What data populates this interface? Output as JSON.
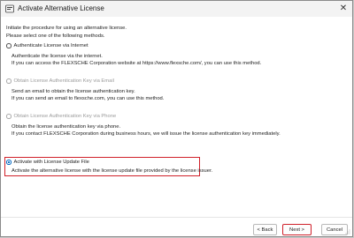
{
  "window": {
    "title": "Activate Alternative License",
    "close_glyph": "✕"
  },
  "intro": {
    "line1": "Initiate the procedure for using an alternative license.",
    "line2": "Please select one of the following methods."
  },
  "options": [
    {
      "label": "Authenticate License via Internet",
      "enabled": true,
      "selected": false,
      "desc1": "Authenticate the license via the internet.",
      "desc2": "If you can access the FLEXSCHE Corporation website at https://www.flexsche.com/, you can use this method."
    },
    {
      "label": "Obtain License Authentication Key via Email",
      "enabled": false,
      "selected": false,
      "desc1": "Send an email to obtain the license authentication key.",
      "desc2": "If you can send an email to flexsche.com, you can use this method."
    },
    {
      "label": "Obtain License Authentication Key via Phone",
      "enabled": false,
      "selected": false,
      "desc1": "Obtain the license authentication key via phone.",
      "desc2": "If you contact FLEXSCHE Corporation during business hours, we will issue the license authentication key immediately."
    },
    {
      "label": "Activate with License Update File",
      "enabled": true,
      "selected": true,
      "desc1": "Activate the alternative license with the license update file provided by the license issuer."
    }
  ],
  "buttons": {
    "back": "< Back",
    "next": "Next >",
    "cancel": "Cancel"
  },
  "colors": {
    "highlight": "#d0202a",
    "radio_accent": "#0067c0"
  },
  "icons": {
    "app": "license-app-icon",
    "close": "close-icon",
    "grip": "resize-grip-icon"
  }
}
